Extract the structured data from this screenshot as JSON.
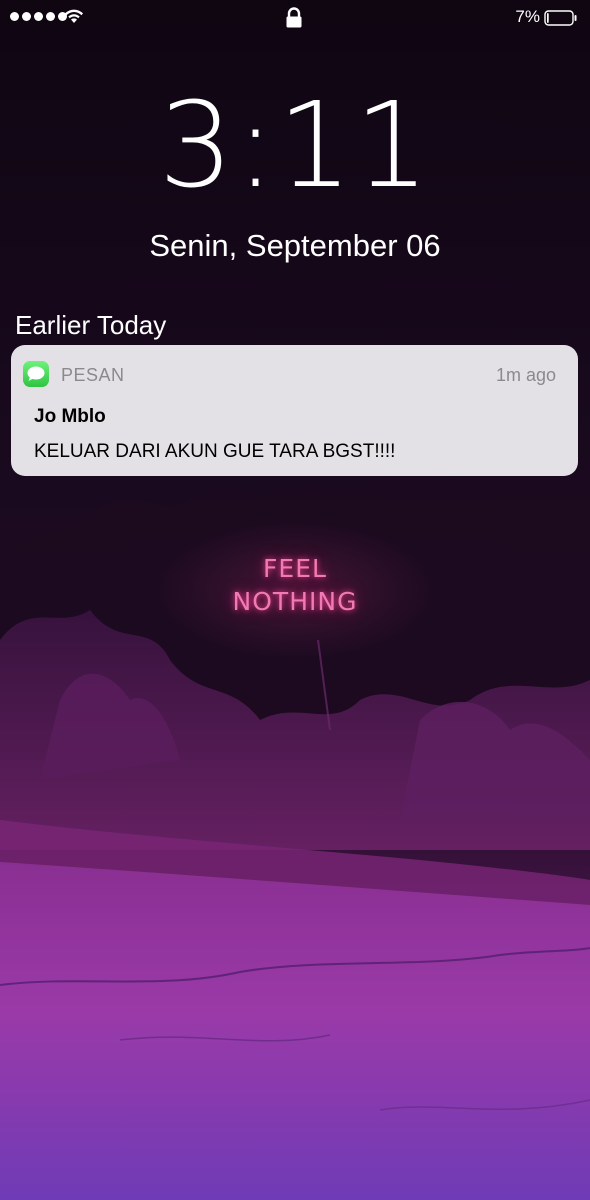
{
  "status_bar": {
    "signal_bars": 5,
    "wifi": "wifi-icon",
    "lock": "lock-icon",
    "battery_percent": "7%",
    "battery_level": 0.07
  },
  "lock_screen": {
    "time": "3:11",
    "date": "Senin, September 06"
  },
  "notifications": {
    "section_title": "Earlier Today",
    "items": [
      {
        "app_icon": "messages-icon",
        "app_name": "PESAN",
        "time_ago": "1m ago",
        "sender": "Jo Mblo",
        "message": "KELUAR DARI AKUN GUE TARA BGST!!!!"
      }
    ]
  },
  "wallpaper": {
    "sign_line_1": "FEEL",
    "sign_line_2": "NOTHING",
    "neon_color": "#f07ab2",
    "road_color": "#7e33a4"
  }
}
